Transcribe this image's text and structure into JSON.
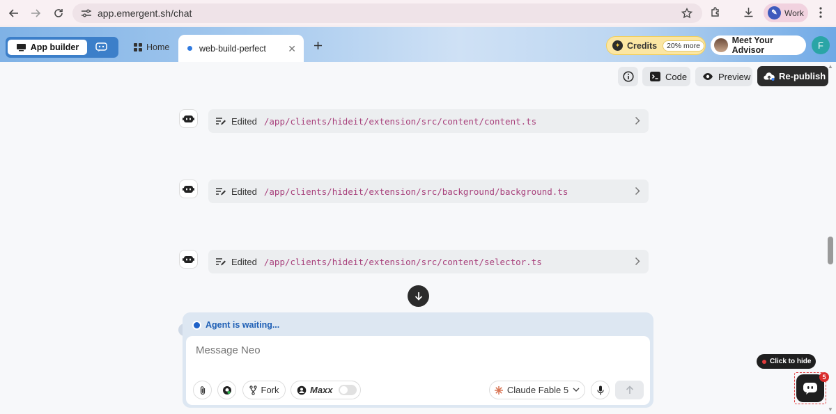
{
  "browser": {
    "url": "app.emergent.sh/chat",
    "profile_label": "Work"
  },
  "header": {
    "mode_app_builder": "App builder",
    "home_tab": "Home",
    "active_tab": "web-build-perfect",
    "credits_label": "Credits",
    "credits_badge": "20% more",
    "advisor_label": "Meet Your Advisor",
    "user_initial": "F"
  },
  "toolbar": {
    "code_label": "Code",
    "preview_label": "Preview",
    "publish_label": "Re-publish"
  },
  "messages": [
    {
      "action": "Edited",
      "path": "/app/clients/hideit/extension/src/content/content.ts"
    },
    {
      "action": "Edited",
      "path": "/app/clients/hideit/extension/src/background/background.ts"
    },
    {
      "action": "Edited",
      "path": "/app/clients/hideit/extension/src/content/selector.ts"
    }
  ],
  "composer": {
    "status": "Agent is waiting...",
    "placeholder": "Message Neo",
    "fork_label": "Fork",
    "maxx_label": "Maxx",
    "maxx_enabled": false,
    "model_label": "Claude Fable 5"
  },
  "widget": {
    "hide_label": "Click to hide",
    "badge_count": "5"
  },
  "colors": {
    "accent_blue": "#1f62c8",
    "path_color": "#a8417c",
    "credits_bg": "#fbe6a3"
  }
}
